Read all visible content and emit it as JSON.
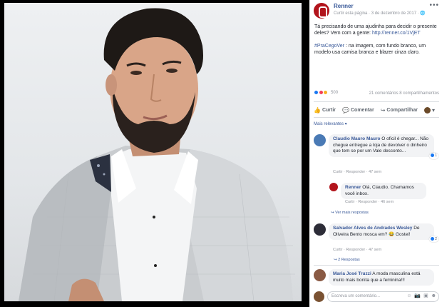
{
  "page": {
    "name": "Renner",
    "meta": "Curtir esta página · 3 de dezembro de 2017 · ",
    "globe": "🌐"
  },
  "post": {
    "line1": "Tá precisando de uma ajudinha para decidir o presente deles? Vem com a gente: ",
    "link": "http://renner.co/1VjET",
    "hashtag": "#PraCegoVer",
    "line2": ": na imagem, com fundo branco, um modelo usa camisa branca e blazer cinza claro."
  },
  "stats": {
    "reactions": "500",
    "summary": "21 comentários 8 compartilhamentos"
  },
  "actions": {
    "like": "Curtir",
    "comment": "Comentar",
    "share": "Compartilhar",
    "like_icon": "thumbs-up-icon",
    "comment_icon": "speech-bubble-icon",
    "share_icon": "share-arrow-icon"
  },
  "sort_label": "Mais relevantes ▾",
  "comments": [
    {
      "author": "Claudio Mauro Mauro",
      "text": "O oficil é chegar... Não chegue entregue a loja de devolver o dinheiro que tem se por um Vale desconto...",
      "meta": "Curtir · Responder · 47 sem",
      "reacts": "1"
    },
    {
      "author": "Renner",
      "text": "Olá, Claudio. Chamamos você inbox.",
      "meta": "Curtir · Responder · 46 sem"
    },
    {
      "more": "↪ Ver mais respostas"
    },
    {
      "author": "Salvador Alves de Andrades Wesley",
      "text": "De Oliveira Bento mosca em? 😂 Gostei!",
      "meta": "Curtir · Responder · 47 sem",
      "reacts": "2",
      "replies": "↪ 2 Respostas"
    },
    {
      "author": "Maria José Truzzi",
      "text": "A moda masculina está muito mais bonita que a feminina!!!"
    }
  ],
  "composer": {
    "placeholder": "Escreva um comentário...",
    "tools": "☺ 📷 ▣ ☻"
  },
  "colors": {
    "brand": "#b2141c",
    "link": "#385898",
    "like": "#1877f2",
    "love": "#f33e58",
    "wow": "#f7b125"
  }
}
